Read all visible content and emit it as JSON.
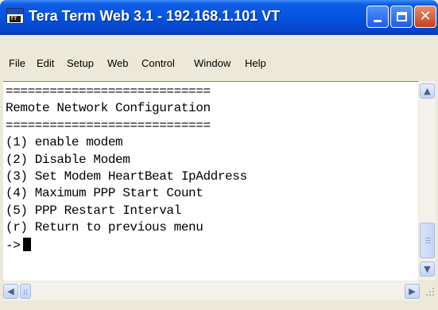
{
  "window": {
    "title": "Tera Term Web 3.1 - 192.168.1.101 VT",
    "icon": "tera-term-app-icon",
    "icon_text": "TT",
    "controls": {
      "minimize_icon": "minimize-icon",
      "maximize_icon": "maximize-icon",
      "close_icon": "close-icon",
      "close_glyph": "✕"
    }
  },
  "menu": {
    "file": "File",
    "edit": "Edit",
    "setup": "Setup",
    "web": "Web",
    "control": "Control",
    "window": "Window",
    "help": "Help"
  },
  "terminal": {
    "lines": [
      "============================",
      "Remote Network Configuration",
      "============================",
      "(1) enable modem",
      "(2) Disable Modem",
      "(3) Set Modem HeartBeat IpAddress",
      "(4) Maximum PPP Start Count",
      "(5) PPP Restart Interval",
      "(r) Return to previous menu"
    ],
    "prompt": "->"
  },
  "scrollbars": {
    "up_glyph": "▲",
    "down_glyph": "▼",
    "left_glyph": "◀",
    "right_glyph": "▶"
  },
  "colors": {
    "titlebar": "#0453e0",
    "terminal_bg": "#ffffff",
    "terminal_text": "#000000",
    "window_chrome": "#ece9d8"
  }
}
